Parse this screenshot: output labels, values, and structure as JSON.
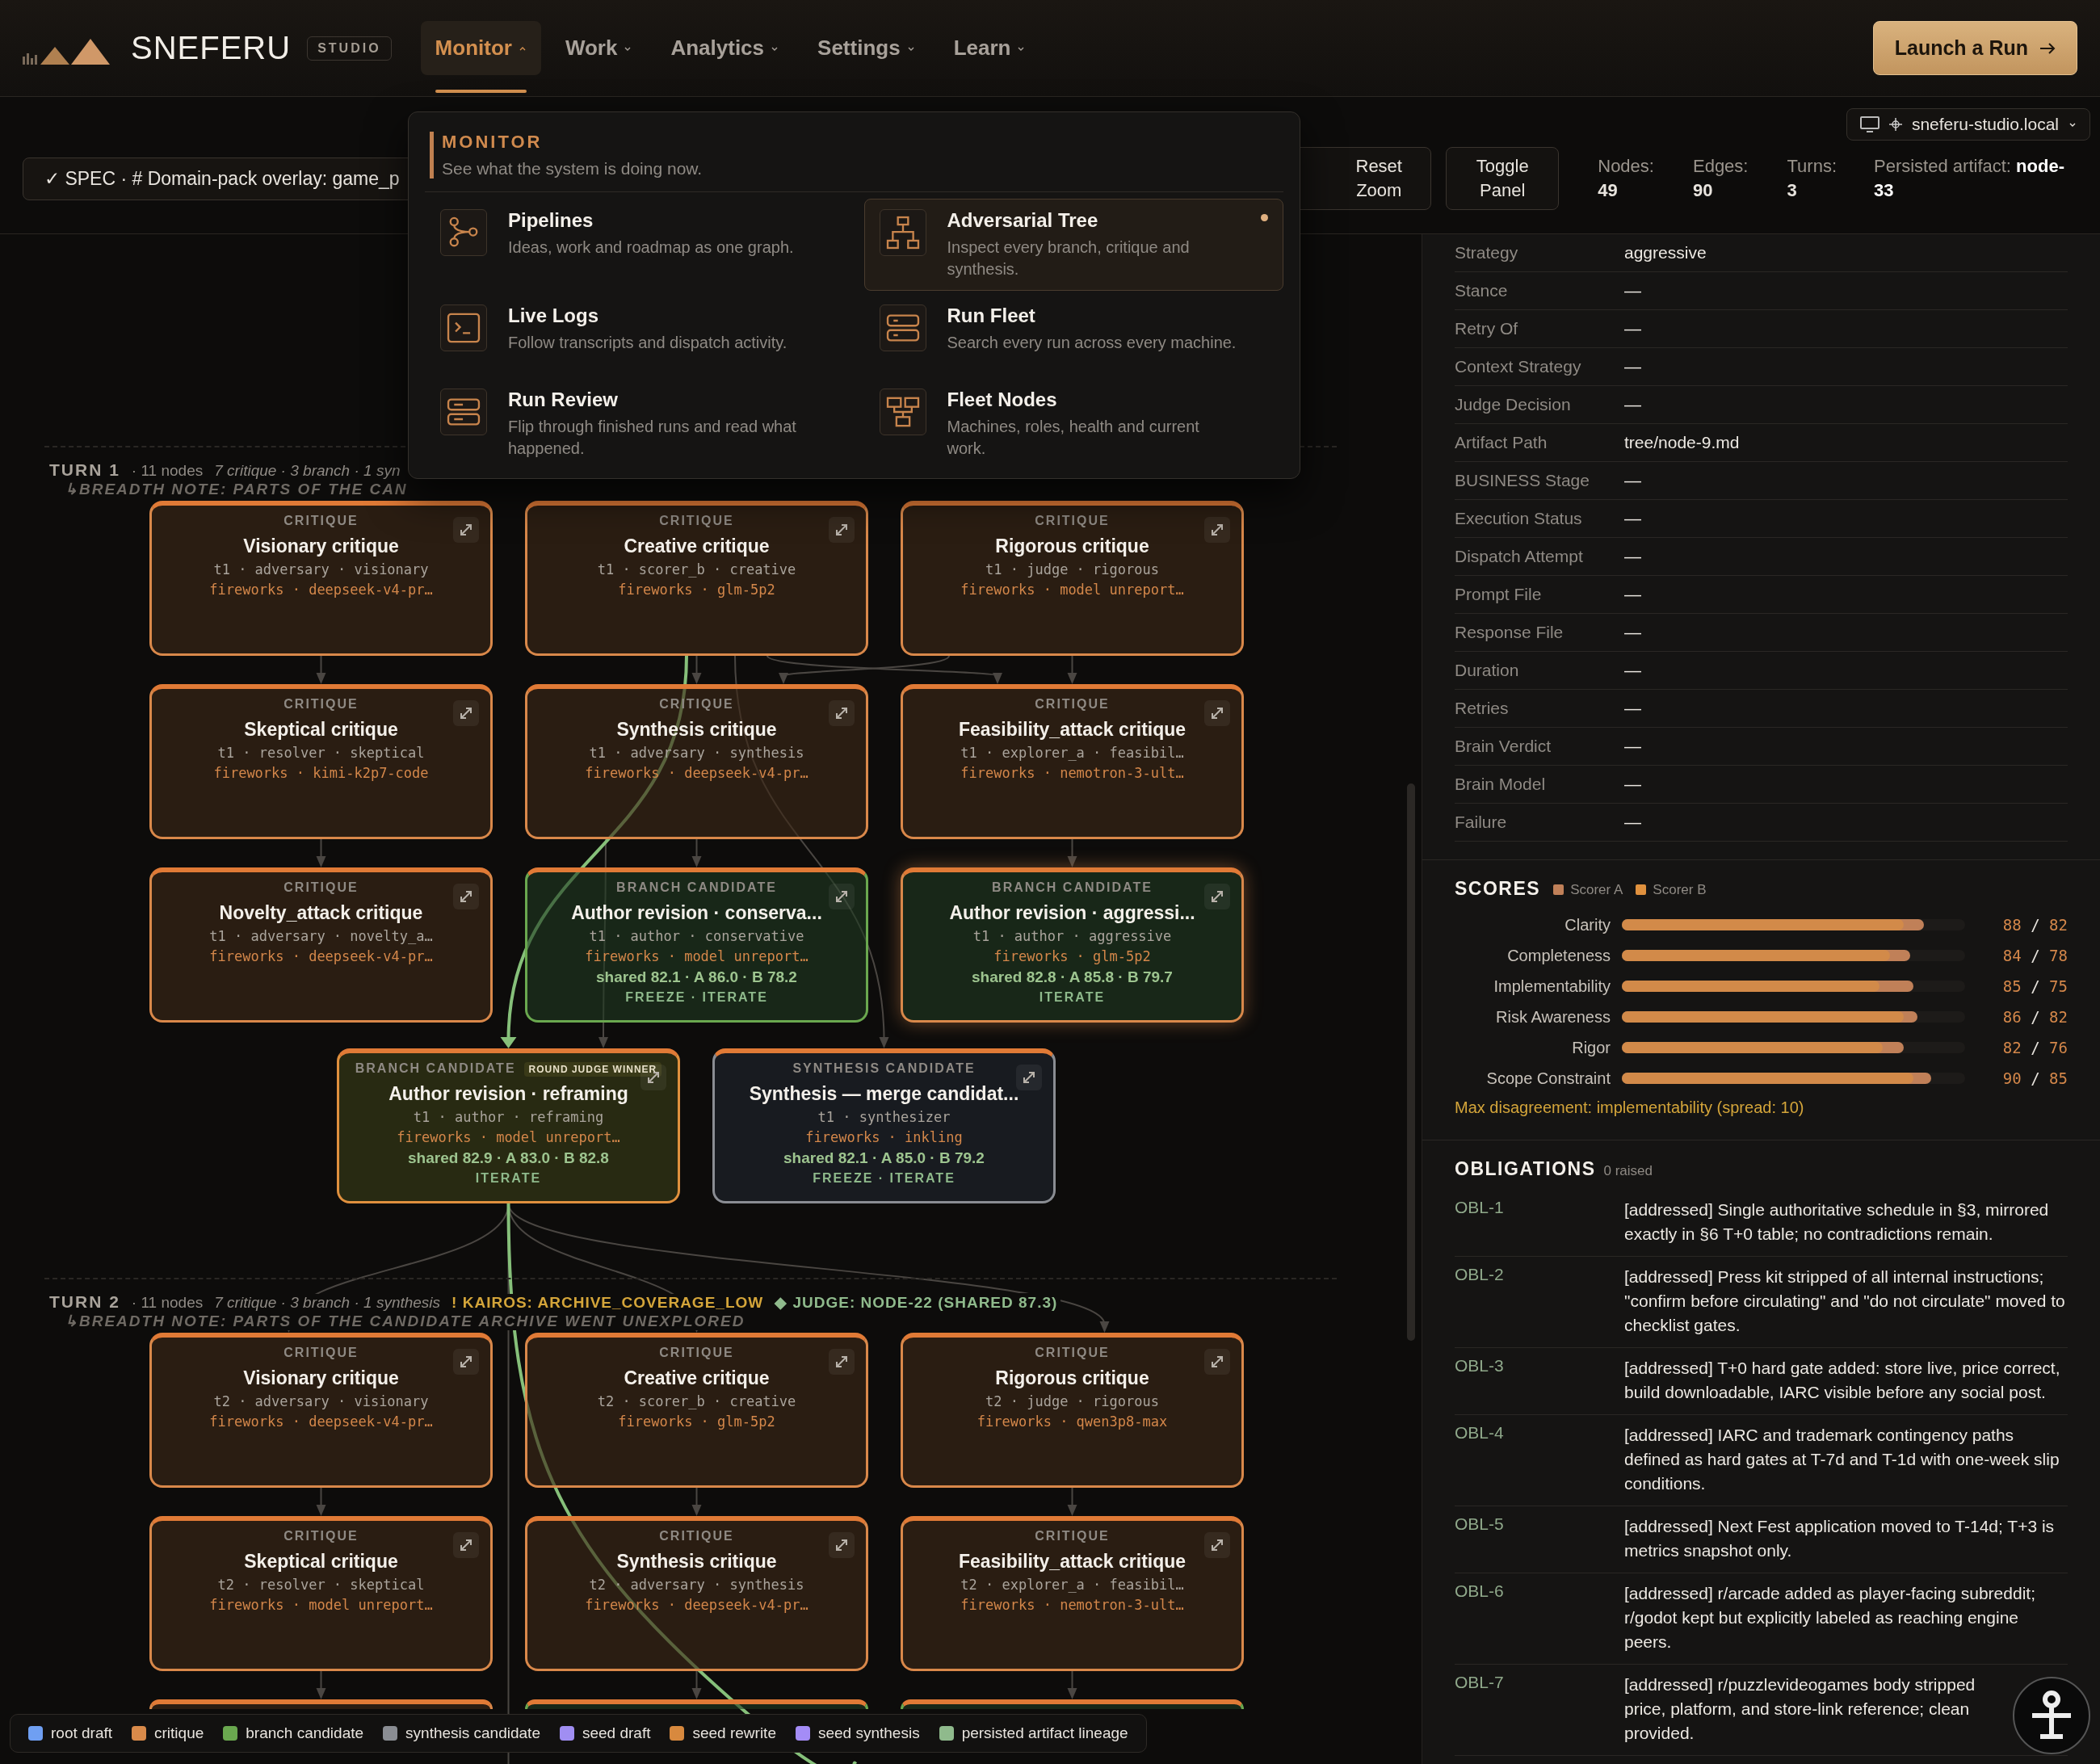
{
  "header": {
    "brand": "SNEFERU",
    "badge": "STUDIO",
    "nav": [
      {
        "label": "Monitor",
        "selected": true
      },
      {
        "label": "Work",
        "selected": false
      },
      {
        "label": "Analytics",
        "selected": false
      },
      {
        "label": "Settings",
        "selected": false
      },
      {
        "label": "Learn",
        "selected": false
      }
    ],
    "launch": "Launch a Run"
  },
  "host": "sneferu-studio.local",
  "toolbar": {
    "spec": "✓ SPEC · # Domain-pack overlay: game_p",
    "buttons": [
      "Reset Zoom",
      "Toggle Panel"
    ],
    "stats": [
      {
        "label": "Nodes:",
        "value": "49"
      },
      {
        "label": "Edges:",
        "value": "90"
      },
      {
        "label": "Turns:",
        "value": "3"
      }
    ],
    "persisted": "Persisted artifact: **node-33**"
  },
  "menu": {
    "title": "MONITOR",
    "subtitle": "See what the system is doing now.",
    "items": [
      {
        "title": "Pipelines",
        "desc": "Ideas, work and roadmap as one graph.",
        "selected": false
      },
      {
        "title": "Adversarial Tree",
        "desc": "Inspect every branch, critique and synthesis.",
        "selected": true
      },
      {
        "title": "Live Logs",
        "desc": "Follow transcripts and dispatch activity.",
        "selected": false
      },
      {
        "title": "Run Fleet",
        "desc": "Search every run across every machine.",
        "selected": false
      },
      {
        "title": "Run Review",
        "desc": "Flip through finished runs and read what happened.",
        "selected": false
      },
      {
        "title": "Fleet Nodes",
        "desc": "Machines, roles, health and current work.",
        "selected": false
      }
    ]
  },
  "canvas": {
    "turns": [
      {
        "title": "TURN 1",
        "count": "· 11 nodes",
        "summary": "7 critique · 3 branch · 1 syn",
        "note": "↳BREADTH NOTE: PARTS OF THE CAN",
        "nodes": [
          {
            "kind": "critique",
            "label": "CRITIQUE",
            "title": "Visionary critique",
            "meta": "t1 · adversary · visionary",
            "model": "fireworks · deepseek-v4-pr…",
            "selected": false,
            "lineage": false
          },
          {
            "kind": "critique",
            "label": "CRITIQUE",
            "title": "Creative critique",
            "meta": "t1 · scorer_b · creative",
            "model": "fireworks · glm-5p2",
            "selected": false,
            "lineage": false
          },
          {
            "kind": "critique",
            "label": "CRITIQUE",
            "title": "Rigorous critique",
            "meta": "t1 · judge · rigorous",
            "model": "fireworks · model unreport…",
            "selected": false,
            "lineage": false
          },
          {
            "kind": "critique",
            "label": "CRITIQUE",
            "title": "Skeptical critique",
            "meta": "t1 · resolver · skeptical",
            "model": "fireworks · kimi-k2p7-code",
            "selected": false,
            "lineage": false
          },
          {
            "kind": "critique",
            "label": "CRITIQUE",
            "title": "Synthesis critique",
            "meta": "t1 · adversary · synthesis",
            "model": "fireworks · deepseek-v4-pr…",
            "selected": false,
            "lineage": false
          },
          {
            "kind": "critique",
            "label": "CRITIQUE",
            "title": "Feasibility_attack critique",
            "meta": "t1 · explorer_a · feasibil…",
            "model": "fireworks · nemotron-3-ult…",
            "selected": false,
            "lineage": false
          },
          {
            "kind": "critique",
            "label": "CRITIQUE",
            "title": "Novelty_attack critique",
            "meta": "t1 · adversary · novelty_a…",
            "model": "fireworks · deepseek-v4-pr…",
            "selected": false,
            "lineage": false
          },
          {
            "kind": "branch",
            "label": "BRANCH CANDIDATE",
            "title": "Author revision · conserva...",
            "meta": "t1 · author · conservative",
            "model": "fireworks · model unreport…",
            "scores": "shared 82.1 · A 86.0 · B 78.2",
            "actions": "FREEZE · ITERATE",
            "selected": false,
            "lineage": false
          },
          {
            "kind": "branch",
            "label": "BRANCH CANDIDATE",
            "title": "Author revision · aggressi...",
            "meta": "t1 · author · aggressive",
            "model": "fireworks · glm-5p2",
            "scores": "shared 82.8 · A 85.8 · B 79.7",
            "actions": "ITERATE",
            "selected": true,
            "lineage": false
          },
          {
            "kind": "winner",
            "label": "BRANCH CANDIDATE",
            "badge": "ROUND JUDGE WINNER",
            "title": "Author revision · reframing",
            "meta": "t1 · author · reframing",
            "model": "fireworks · model unreport…",
            "scores": "shared 82.9 · A 83.0 · B 82.8",
            "actions": "ITERATE",
            "selected": false,
            "lineage": true
          },
          {
            "kind": "synthesis",
            "label": "SYNTHESIS CANDIDATE",
            "title": "Synthesis — merge candidat...",
            "meta": "t1 · synthesizer",
            "model": "fireworks · inkling",
            "scores": "shared 82.1 · A 85.0 · B 79.2",
            "actions": "FREEZE · ITERATE",
            "selected": false,
            "lineage": false
          }
        ]
      },
      {
        "title": "TURN 2",
        "count": "· 11 nodes",
        "summary": "7 critique · 3 branch · 1 synthesis",
        "flags": [
          {
            "kind": "warning",
            "text": "! KAIROS: ARCHIVE_COVERAGE_LOW"
          },
          {
            "kind": "judge",
            "text": "◆ JUDGE: NODE-22 (SHARED 87.3)"
          }
        ],
        "note": "↳BREADTH NOTE: PARTS OF THE CANDIDATE ARCHIVE WENT UNEXPLORED",
        "nodes": [
          {
            "kind": "critique",
            "label": "CRITIQUE",
            "title": "Visionary critique",
            "meta": "t2 · adversary · visionary",
            "model": "fireworks · deepseek-v4-pr…",
            "selected": false,
            "lineage": false
          },
          {
            "kind": "critique",
            "label": "CRITIQUE",
            "title": "Creative critique",
            "meta": "t2 · scorer_b · creative",
            "model": "fireworks · glm-5p2",
            "selected": false,
            "lineage": false
          },
          {
            "kind": "critique",
            "label": "CRITIQUE",
            "title": "Rigorous critique",
            "meta": "t2 · judge · rigorous",
            "model": "fireworks · qwen3p8-max",
            "selected": false,
            "lineage": false
          },
          {
            "kind": "critique",
            "label": "CRITIQUE",
            "title": "Skeptical critique",
            "meta": "t2 · resolver · skeptical",
            "model": "fireworks · model unreport…",
            "selected": false,
            "lineage": false
          },
          {
            "kind": "critique",
            "label": "CRITIQUE",
            "title": "Synthesis critique",
            "meta": "t2 · adversary · synthesis",
            "model": "fireworks · deepseek-v4-pr…",
            "selected": false,
            "lineage": false
          },
          {
            "kind": "critique",
            "label": "CRITIQUE",
            "title": "Feasibility_attack critique",
            "meta": "t2 · explorer_a · feasibil…",
            "model": "fireworks · nemotron-3-ult…",
            "selected": false,
            "lineage": false
          },
          {
            "kind": "critique",
            "selected": false,
            "lineage": false
          },
          {
            "kind": "branch",
            "selected": false,
            "lineage": false
          },
          {
            "kind": "branch",
            "selected": false,
            "lineage": false
          }
        ]
      }
    ]
  },
  "legend": [
    {
      "label": "root draft",
      "color": "#6f9ff2"
    },
    {
      "label": "critique",
      "color": "#d98a4a"
    },
    {
      "label": "branch candidate",
      "color": "#6aa84f"
    },
    {
      "label": "synthesis candidate",
      "color": "#8a8d93"
    },
    {
      "label": "seed draft",
      "color": "#a08ef2"
    },
    {
      "label": "seed rewrite",
      "color": "#d8893e"
    },
    {
      "label": "seed synthesis",
      "color": "#a48cf6"
    },
    {
      "label": "persisted artifact lineage",
      "color": "#8fba8c"
    }
  ],
  "details": [
    {
      "label": "Strategy",
      "value": "aggressive"
    },
    {
      "label": "Stance",
      "value": "—"
    },
    {
      "label": "Retry Of",
      "value": "—"
    },
    {
      "label": "Context Strategy",
      "value": "—"
    },
    {
      "label": "Judge Decision",
      "value": "—"
    },
    {
      "label": "Artifact Path",
      "value": "tree/node-9.md"
    },
    {
      "label": "BUSINESS Stage",
      "value": "—"
    },
    {
      "label": "Execution Status",
      "value": "—"
    },
    {
      "label": "Dispatch Attempt",
      "value": "—"
    },
    {
      "label": "Prompt File",
      "value": "—"
    },
    {
      "label": "Response File",
      "value": "—"
    },
    {
      "label": "Duration",
      "value": "—"
    },
    {
      "label": "Retries",
      "value": "—"
    },
    {
      "label": "Brain Verdict",
      "value": "—"
    },
    {
      "label": "Brain Model",
      "value": "—"
    },
    {
      "label": "Failure",
      "value": "—"
    }
  ],
  "scores": {
    "title": "SCORES",
    "separator": "/",
    "scorers": [
      {
        "label": "Scorer A",
        "color": "#c08058"
      },
      {
        "label": "Scorer B",
        "color": "#e0913e"
      }
    ],
    "rows": [
      {
        "label": "Clarity",
        "a": {
          "value": "88",
          "level": 0.88
        },
        "b": {
          "value": "82",
          "level": 0.82
        }
      },
      {
        "label": "Completeness",
        "a": {
          "value": "84",
          "level": 0.84
        },
        "b": {
          "value": "78",
          "level": 0.78
        }
      },
      {
        "label": "Implementability",
        "a": {
          "value": "85",
          "level": 0.85
        },
        "b": {
          "value": "75",
          "level": 0.75
        }
      },
      {
        "label": "Risk Awareness",
        "a": {
          "value": "86",
          "level": 0.86
        },
        "b": {
          "value": "82",
          "level": 0.82
        }
      },
      {
        "label": "Rigor",
        "a": {
          "value": "82",
          "level": 0.82
        },
        "b": {
          "value": "76",
          "level": 0.76
        }
      },
      {
        "label": "Scope Constraint",
        "a": {
          "value": "90",
          "level": 0.9
        },
        "b": {
          "value": "85",
          "level": 0.85
        }
      }
    ],
    "note": "Max disagreement: implementability (spread: 10)"
  },
  "obligations": {
    "title": "OBLIGATIONS",
    "count": "0 raised",
    "items": [
      {
        "id": "OBL-1",
        "text": "[addressed] Single authoritative schedule in §3, mirrored exactly in §6 T+0 table; no contradictions remain."
      },
      {
        "id": "OBL-2",
        "text": "[addressed] Press kit stripped of all internal instructions; \"confirm before circulating\" and \"do not circulate\" moved to checklist gates."
      },
      {
        "id": "OBL-3",
        "text": "[addressed] T+0 hard gate added: store live, price correct, build downloadable, IARC visible before any social post."
      },
      {
        "id": "OBL-4",
        "text": "[addressed] IARC and trademark contingency paths defined as hard gates at T-7d and T-1d with one-week slip conditions."
      },
      {
        "id": "OBL-5",
        "text": "[addressed] Next Fest application moved to T-14d; T+3 is metrics snapshot only."
      },
      {
        "id": "OBL-6",
        "text": "[addressed] r/arcade added as player-facing subreddit; r/godot kept but explicitly labeled as reaching engine peers."
      },
      {
        "id": "OBL-7",
        "text": "[addressed] r/puzzlevideogames body stripped price, platform, and store-link reference; clean provided."
      }
    ]
  }
}
